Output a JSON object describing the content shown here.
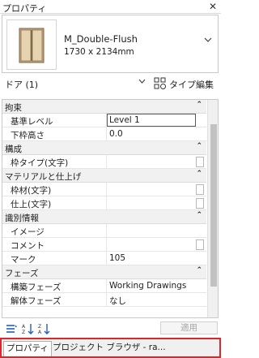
{
  "window": {
    "title": "プロパティ",
    "close_glyph": "✕"
  },
  "type_selector": {
    "name": "M_Double-Flush",
    "size": "1730 x 2134mm",
    "icon": "door-thumbnail-icon"
  },
  "filter": {
    "label": "ドア (1)",
    "edit_type_label": "タイプ編集"
  },
  "groups": [
    {
      "name": "拘束",
      "rows": [
        {
          "label": "基準レベル",
          "value": "Level 1"
        },
        {
          "label": "下枠高さ",
          "value": "0.0"
        }
      ]
    },
    {
      "name": "構成",
      "rows": [
        {
          "label": "枠タイプ(文字)",
          "value": ""
        }
      ]
    },
    {
      "name": "マテリアルと仕上げ",
      "rows": [
        {
          "label": "枠材(文字)",
          "value": ""
        },
        {
          "label": "仕上(文字)",
          "value": ""
        }
      ]
    },
    {
      "name": "識別情報",
      "rows": [
        {
          "label": "イメージ",
          "value": ""
        },
        {
          "label": "コメント",
          "value": ""
        },
        {
          "label": "マーク",
          "value": "105"
        }
      ]
    },
    {
      "name": "フェーズ",
      "rows": [
        {
          "label": "構築フェーズ",
          "value": "Working Drawings"
        },
        {
          "label": "解体フェーズ",
          "value": "なし"
        }
      ]
    }
  ],
  "collapse_glyph": "⌃",
  "toolbar": {
    "apply_label": "適用"
  },
  "tabs": [
    {
      "label": "プロパティ"
    },
    {
      "label": "プロジェクト ブラウザ - ra..."
    }
  ]
}
